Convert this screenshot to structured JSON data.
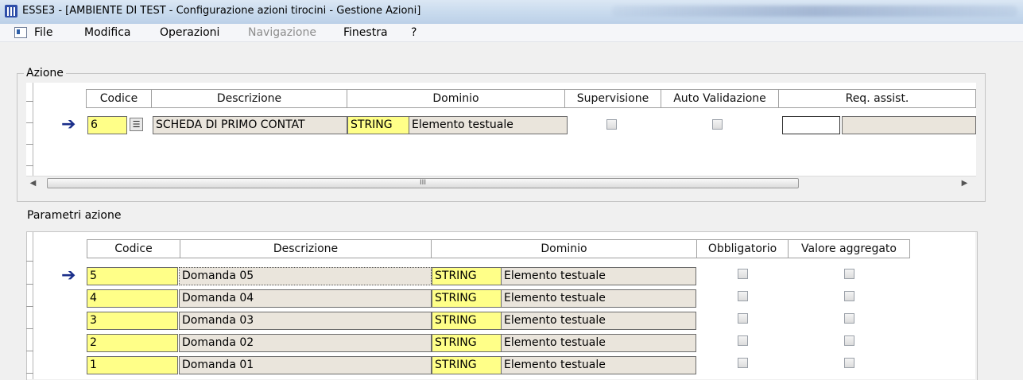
{
  "window": {
    "title": "ESSE3 - [AMBIENTE DI TEST - Configurazione azioni tirocini - Gestione Azioni]"
  },
  "menu": [
    {
      "label": "File",
      "enabled": true
    },
    {
      "label": "Modifica",
      "enabled": true
    },
    {
      "label": "Operazioni",
      "enabled": true
    },
    {
      "label": "Navigazione",
      "enabled": false
    },
    {
      "label": "Finestra",
      "enabled": true
    },
    {
      "label": "?",
      "enabled": true
    }
  ],
  "azione": {
    "section_label": "Azione",
    "headers": [
      "Codice",
      "Descrizione",
      "Dominio",
      "Supervisione",
      "Auto Validazione",
      "Req. assist."
    ],
    "row": {
      "codice": "6",
      "descrizione": "SCHEDA DI PRIMO CONTAT",
      "dominio_code": "STRING",
      "dominio_desc": "Elemento testuale",
      "supervisione": false,
      "auto_validazione": false,
      "req_assist_value": ""
    },
    "scroll_thumb_grip": "III"
  },
  "parametri": {
    "section_label": "Parametri azione",
    "headers": [
      "Codice",
      "Descrizione",
      "Dominio",
      "Obbligatorio",
      "Valore aggregato"
    ],
    "rows": [
      {
        "codice": "5",
        "descrizione": "Domanda 05",
        "dominio_code": "STRING",
        "dominio_desc": "Elemento testuale",
        "obbligatorio": false,
        "valore_aggregato": false
      },
      {
        "codice": "4",
        "descrizione": "Domanda 04",
        "dominio_code": "STRING",
        "dominio_desc": "Elemento testuale",
        "obbligatorio": false,
        "valore_aggregato": false
      },
      {
        "codice": "3",
        "descrizione": "Domanda 03",
        "dominio_code": "STRING",
        "dominio_desc": "Elemento testuale",
        "obbligatorio": false,
        "valore_aggregato": false
      },
      {
        "codice": "2",
        "descrizione": "Domanda 02",
        "dominio_code": "STRING",
        "dominio_desc": "Elemento testuale",
        "obbligatorio": false,
        "valore_aggregato": false
      },
      {
        "codice": "1",
        "descrizione": "Domanda 01",
        "dominio_code": "STRING",
        "dominio_desc": "Elemento testuale",
        "obbligatorio": false,
        "valore_aggregato": false
      }
    ]
  },
  "colors": {
    "required_field": "#ffff88",
    "readonly_field": "#eae5dc",
    "current_row_arrow": "#1a2e8a",
    "titlebar": "#c9dbee"
  },
  "icons": {
    "app": "esse3-app-icon",
    "menu_system": "document-menu-icon",
    "current_row": "arrow-right-icon",
    "lov": "list-of-values-icon",
    "scroll_left": "scroll-left-icon",
    "scroll_right": "scroll-right-icon"
  }
}
